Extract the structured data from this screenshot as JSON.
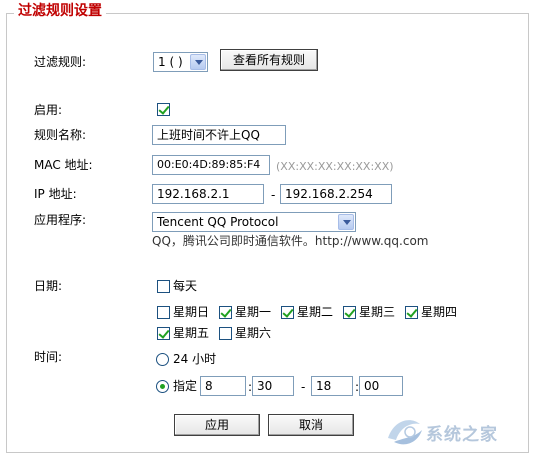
{
  "legend": "过滤规则设置",
  "rule": {
    "label": "过滤规则:",
    "selected": "1 ( )",
    "view_all_button": "查看所有规则"
  },
  "enable": {
    "label": "启用:",
    "checked": true
  },
  "rule_name": {
    "label": "规则名称:",
    "value": "上班时间不许上QQ"
  },
  "mac": {
    "label": "MAC 地址:",
    "value": "00:E0:4D:89:85:F4",
    "hint": "(XX:XX:XX:XX:XX:XX)"
  },
  "ip": {
    "label": "IP 地址:",
    "start": "192.168.2.1",
    "dash": "-",
    "end": "192.168.2.254"
  },
  "app": {
    "label": "应用程序:",
    "selected": "Tencent QQ Protocol",
    "description": "QQ，腾讯公司即时通信软件。http://www.qq.com"
  },
  "date": {
    "label": "日期:",
    "everyday": {
      "label": "每天",
      "checked": false
    },
    "days": [
      {
        "label": "星期日",
        "checked": false
      },
      {
        "label": "星期一",
        "checked": true
      },
      {
        "label": "星期二",
        "checked": true
      },
      {
        "label": "星期三",
        "checked": true
      },
      {
        "label": "星期四",
        "checked": true
      },
      {
        "label": "星期五",
        "checked": true
      },
      {
        "label": "星期六",
        "checked": false
      }
    ]
  },
  "time": {
    "label": "时间:",
    "all_day": {
      "label": "24 小时",
      "checked": false
    },
    "specify": {
      "label": "指定",
      "start_hour": "8",
      "colon": ":",
      "start_min": "30",
      "dash": "-",
      "end_hour": "18",
      "end_min": "00",
      "checked": true
    }
  },
  "buttons": {
    "apply": "应用",
    "cancel": "取消"
  },
  "watermark": {
    "text": "系统之家"
  },
  "colors": {
    "legend": "#c00000",
    "check": "#21a121",
    "border": "#7f9db9"
  }
}
